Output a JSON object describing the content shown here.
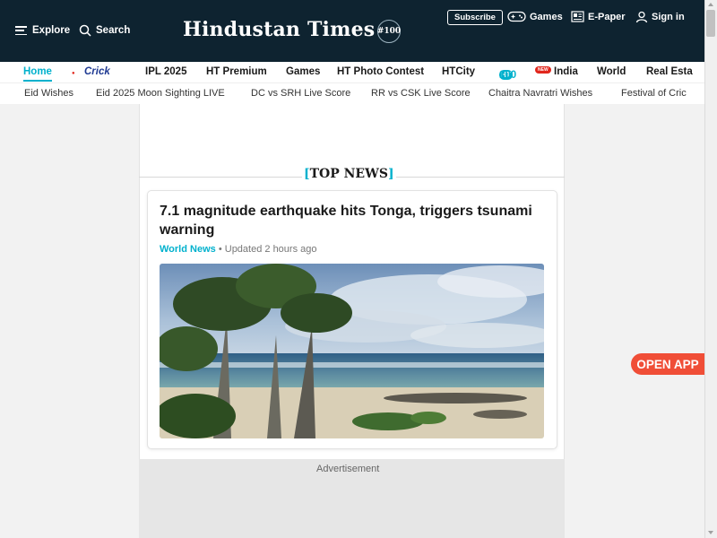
{
  "header": {
    "explore_label": "Explore",
    "search_label": "Search",
    "logo_text": "Hindustan Times",
    "logo_badge": "#100",
    "subscribe_label": "Subscribe",
    "games_label": "Games",
    "epaper_label": "E-Paper",
    "signin_label": "Sign in"
  },
  "nav": {
    "primary": [
      "Home",
      "Crick",
      "IPL 2025",
      "HT Premium",
      "Games",
      "HT Photo Contest",
      "HTCity",
      "India",
      "World",
      "Real Esta"
    ],
    "ht100_badge": "HT",
    "ht100_num": "100",
    "new_badge": "NEW",
    "secondary": [
      "Eid Wishes",
      "Eid 2025 Moon Sighting LIVE",
      "DC vs SRH Live Score",
      "RR vs CSK Live Score",
      "Chaitra Navratri Wishes",
      "Festival of Cric"
    ]
  },
  "top_news": {
    "bracket_open": "[",
    "label": "TOP NEWS",
    "bracket_close": "]"
  },
  "article": {
    "headline": "7.1 magnitude earthquake hits Tonga, triggers tsunami warning",
    "category": "World News",
    "separator": "•",
    "updated": "Updated 2 hours ago"
  },
  "ad": {
    "label": "Advertisement"
  },
  "open_app_label": "OPEN APP",
  "colors": {
    "header_bg": "#0e2330",
    "accent": "#00b1cd",
    "open_app": "#f04e37"
  }
}
